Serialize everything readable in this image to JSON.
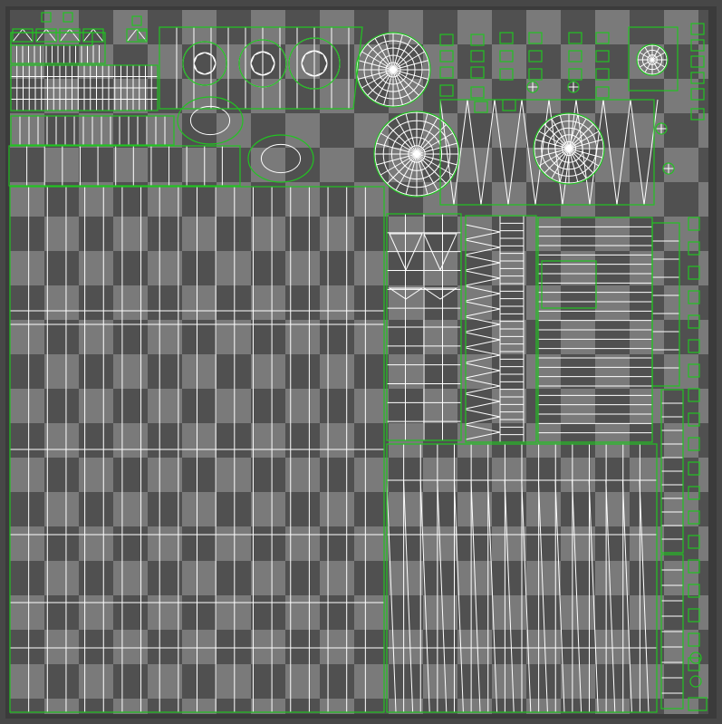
{
  "editor": {
    "view": "UV layout",
    "checker_light": "#7a7a7a",
    "checker_dark": "#505050",
    "frame_color": "#474747",
    "wire_color": "#ffffff",
    "island_border_color": "#22c322"
  },
  "islands": [
    {
      "name": "top-left-strips"
    },
    {
      "name": "round-hub-top"
    },
    {
      "name": "radial-disc-large-top"
    },
    {
      "name": "radial-disc-center"
    },
    {
      "name": "radial-disc-right"
    },
    {
      "name": "large-floor-island"
    },
    {
      "name": "triangle-strip-column"
    },
    {
      "name": "bottom-right-island"
    },
    {
      "name": "small-round-parts-column"
    }
  ]
}
